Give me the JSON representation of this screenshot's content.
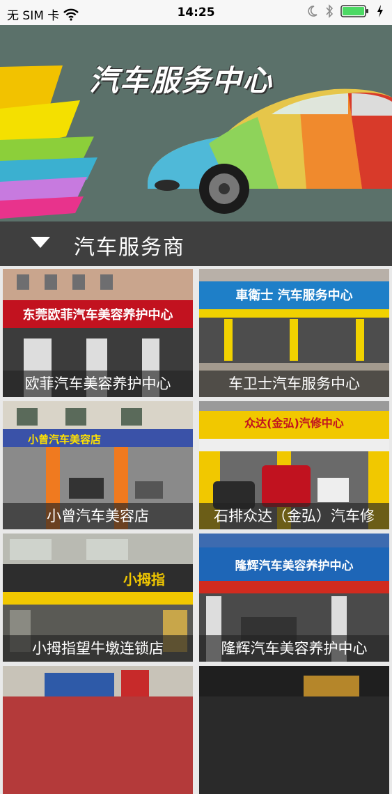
{
  "status_bar": {
    "carrier": "无 SIM 卡",
    "time": "14:25"
  },
  "banner": {
    "title": "汽车服务中心"
  },
  "section": {
    "label": "汽车服务商"
  },
  "tiles": [
    {
      "name": "欧菲汽车美容养护中心",
      "sign": "东莞欧菲汽车美容养护中心"
    },
    {
      "name": "车卫士汽车服务中心",
      "sign": "車衛士 汽车服务中心"
    },
    {
      "name": "小曾汽车美容店",
      "sign": "小曾汽车美容店"
    },
    {
      "name": "石排众达（金弘）汽车修",
      "sign": "众达(金弘)汽修中心"
    },
    {
      "name": "小拇指望牛墩连锁店",
      "sign": "小拇指"
    },
    {
      "name": "隆辉汽车美容养护中心",
      "sign": "隆辉汽车美容养护中心"
    }
  ]
}
